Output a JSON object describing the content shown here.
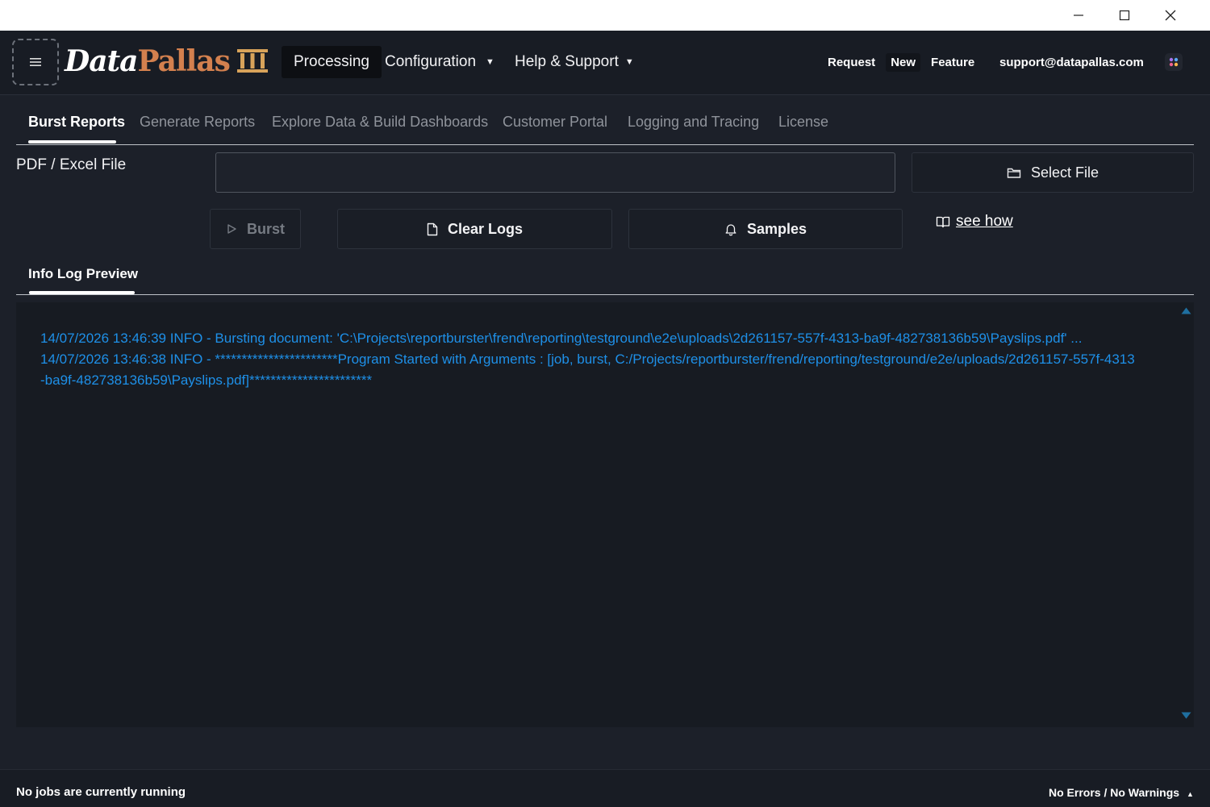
{
  "window": {
    "controls": [
      "minimize-icon",
      "maximize-icon",
      "close-icon"
    ]
  },
  "header": {
    "logo": {
      "part1": "Data",
      "part2": "Pallas"
    },
    "nav": [
      {
        "label": "Processing",
        "active": true
      },
      {
        "label": "Configuration",
        "dropdown": true
      },
      {
        "label": "Help & Support",
        "dropdown": true
      }
    ],
    "request_feature": {
      "word1": "Request",
      "word2": "New",
      "word3": "Feature"
    },
    "support_email": "support@datapallas.com"
  },
  "tabs": [
    {
      "label": "Burst Reports",
      "active": true
    },
    {
      "label": "Generate Reports"
    },
    {
      "label": "Explore Data & Build Dashboards"
    },
    {
      "label": "Customer Portal"
    },
    {
      "label": "Logging and Tracing"
    },
    {
      "label": "License"
    }
  ],
  "form": {
    "file_label": "PDF / Excel File",
    "file_value": "",
    "select_file": "Select File",
    "burst": "Burst",
    "clear_logs": "Clear Logs",
    "samples": "Samples",
    "see_how": "see how"
  },
  "log": {
    "tab_label": "Info Log Preview",
    "lines": [
      "14/07/2026 13:46:39 INFO - Bursting document: 'C:\\Projects\\reportburster\\frend\\reporting\\testground\\e2e\\uploads\\2d261157-557f-4313-ba9f-482738136b59\\Payslips.pdf' ...",
      "14/07/2026 13:46:38 INFO - ***********************Program Started with Arguments : [job, burst, C:/Projects/reportburster/frend/reporting/testground/e2e/uploads/2d261157-557f-4313-ba9f-482738136b59\\Payslips.pdf]***********************"
    ]
  },
  "status": {
    "jobs": "No jobs are currently running",
    "errors": "No Errors / No Warnings"
  },
  "colors": {
    "background": "#1c2029",
    "header": "#181c24",
    "logo_accent": "#d3804e",
    "log_text": "#1e90e8",
    "scroll_arrow": "#1f6fa0"
  }
}
